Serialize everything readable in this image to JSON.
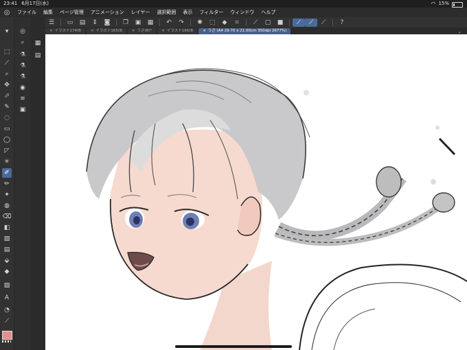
{
  "status": {
    "time": "23:41",
    "date": "6月17日(水)",
    "battery": "15%"
  },
  "menu": [
    "ファイル",
    "編集",
    "ページ管理",
    "アニメーション",
    "レイヤー",
    "選択範囲",
    "表示",
    "フィルター",
    "ウィンドウ",
    "ヘルプ"
  ],
  "tabs": [
    {
      "label": "イラスト174(B"
    },
    {
      "label": "イラスト165(B"
    },
    {
      "label": "うさ(B)*"
    },
    {
      "label": "イラスト166(B"
    },
    {
      "label": "うさ (A4 29.70 x 21.00cm 350dpi 2677%)"
    }
  ],
  "colors": {
    "accent": "#4b6a9b",
    "main_color": "#e98b8b"
  }
}
